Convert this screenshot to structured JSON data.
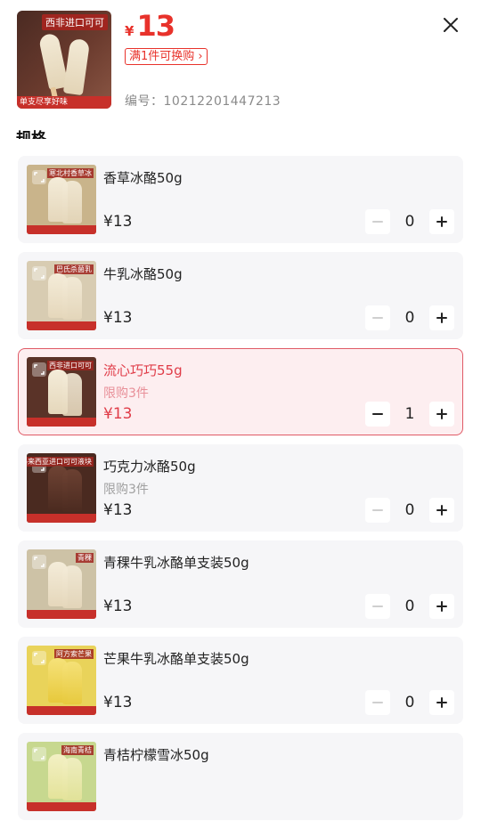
{
  "header": {
    "price_currency": "¥",
    "price_value": "13",
    "promo_label": "满1件可换购 ›",
    "sku_label": "编号：",
    "sku_value": "10212201447213",
    "hero_badge": "西非进口可可",
    "hero_bar_text": "单支尽享好味",
    "section_title": "规格"
  },
  "items": [
    {
      "name": "香草冰酪50g",
      "limit": "",
      "price": "¥13",
      "qty": "0",
      "selected": false,
      "thumb": {
        "bg": "#c9b48b",
        "pop": "vanilla",
        "tag": "寒北村香草冰"
      }
    },
    {
      "name": "牛乳冰酪50g",
      "limit": "",
      "price": "¥13",
      "qty": "0",
      "selected": false,
      "thumb": {
        "bg": "#d8ccb2",
        "pop": "vanilla",
        "tag": "巴氏杀菌乳"
      }
    },
    {
      "name": "流心巧巧55g",
      "limit": "限购3件",
      "price": "¥13",
      "qty": "1",
      "selected": true,
      "thumb": {
        "bg": "#5a3328",
        "pop": "vanilla",
        "tag": "西非进口可可"
      }
    },
    {
      "name": "巧克力冰酪50g",
      "limit": "限购3件",
      "price": "¥13",
      "qty": "0",
      "selected": false,
      "thumb": {
        "bg": "#4a2a20",
        "pop": "choc",
        "tag": "马来西亚进口可可液块"
      }
    },
    {
      "name": "青稞牛乳冰酪单支装50g",
      "limit": "",
      "price": "¥13",
      "qty": "0",
      "selected": false,
      "thumb": {
        "bg": "#cdc2a6",
        "pop": "vanilla",
        "tag": "青稞"
      }
    },
    {
      "name": "芒果牛乳冰酪单支装50g",
      "limit": "",
      "price": "¥13",
      "qty": "0",
      "selected": false,
      "thumb": {
        "bg": "#e9d35a",
        "pop": "mango",
        "tag": "阿方索芒果"
      }
    },
    {
      "name": "青桔柠檬雪冰50g",
      "limit": "",
      "price": "",
      "qty": "",
      "selected": false,
      "thumb": {
        "bg": "#c7d88f",
        "pop": "lime",
        "tag": "海南青桔"
      }
    }
  ],
  "colors": {
    "accent": "#e8322b",
    "selected_bg": "#fdeef0",
    "selected_border": "#e05a66",
    "card_bg": "#f6f6f8"
  },
  "icons": {
    "close": "close-icon",
    "minus": "minus-icon",
    "plus": "plus-icon",
    "expand": "expand-icon"
  }
}
